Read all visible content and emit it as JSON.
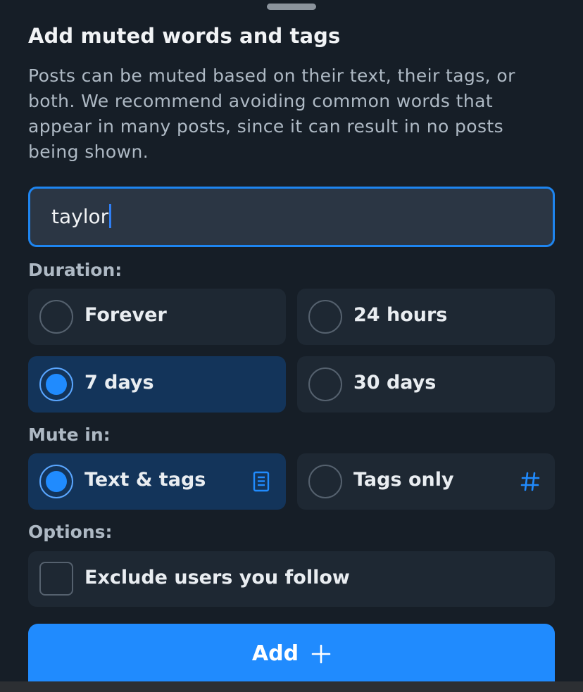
{
  "dialog": {
    "title": "Add muted words and tags",
    "description": "Posts can be muted based on their text, their tags, or both. We recommend avoiding common words that appear in many posts, since it can result in no posts being shown."
  },
  "input": {
    "value": "taylor"
  },
  "duration": {
    "label": "Duration:",
    "options": [
      {
        "label": "Forever",
        "selected": false
      },
      {
        "label": "24 hours",
        "selected": false
      },
      {
        "label": "7 days",
        "selected": true
      },
      {
        "label": "30 days",
        "selected": false
      }
    ]
  },
  "mute_in": {
    "label": "Mute in:",
    "options": [
      {
        "label": "Text & tags",
        "selected": true,
        "icon": "document-icon"
      },
      {
        "label": "Tags only",
        "selected": false,
        "icon": "hashtag-icon"
      }
    ]
  },
  "options": {
    "label": "Options:",
    "exclude_following": {
      "label": "Exclude users you follow",
      "checked": false
    }
  },
  "add_button": {
    "label": "Add"
  },
  "colors": {
    "background": "#161e27",
    "card": "#1e2833",
    "selected_card": "#13345a",
    "accent": "#208bfe",
    "input_border": "#1e85f0"
  }
}
